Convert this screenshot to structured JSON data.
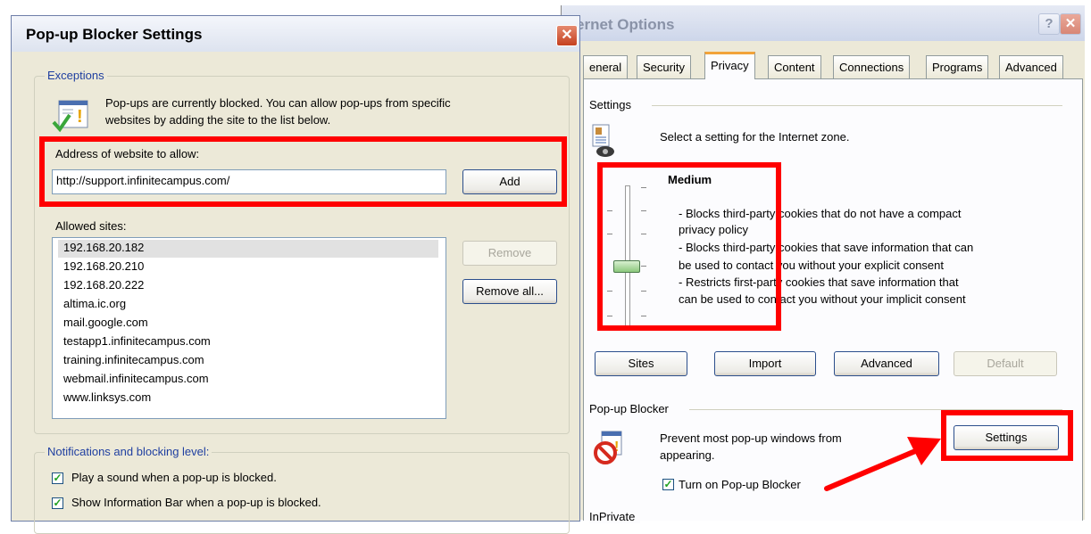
{
  "internet_options": {
    "title": "ernet Options",
    "help_glyph": "?",
    "close_glyph": "✕",
    "tabs": [
      "eneral",
      "Security",
      "Privacy",
      "Content",
      "Connections",
      "Programs",
      "Advanced"
    ],
    "settings_label": "Settings",
    "zone_text": "Select a setting for the Internet zone.",
    "level_name": "Medium",
    "level_desc": [
      "- Blocks third-party cookies that do not have a compact",
      "privacy policy",
      "- Blocks third-party cookies that save information that can",
      "be used to contact you without your explicit consent",
      "- Restricts first-party cookies that save information that",
      "can be used to contact you without your implicit consent"
    ],
    "buttons": {
      "sites": "Sites",
      "import": "Import",
      "advanced": "Advanced",
      "default": "Default"
    },
    "popup_label": "Pop-up Blocker",
    "popup_text_1": "Prevent most pop-up windows from",
    "popup_text_2": "appearing.",
    "popup_settings": "Settings",
    "turn_on_label": "Turn on Pop-up Blocker",
    "inprivate_label": "InPrivate"
  },
  "popup_blocker": {
    "title": "Pop-up Blocker Settings",
    "close_glyph": "✕",
    "exceptions_label": "Exceptions",
    "info_line_1": "Pop-ups are currently blocked.  You can allow pop-ups from specific",
    "info_line_2": "websites by adding the site to the list below.",
    "address_label": "Address of website to allow:",
    "address_value": "http://support.infinitecampus.com/",
    "add_button": "Add",
    "allowed_label": "Allowed sites:",
    "allowed_sites": [
      "192.168.20.182",
      "192.168.20.210",
      "192.168.20.222",
      "altima.ic.org",
      "mail.google.com",
      "testapp1.infinitecampus.com",
      "training.infinitecampus.com",
      "webmail.infinitecampus.com",
      "www.linksys.com"
    ],
    "remove_button": "Remove",
    "remove_all_button": "Remove all...",
    "notifications_label": "Notifications and blocking level:",
    "check_sound": "Play a sound when a pop-up is blocked.",
    "check_infobar": "Show Information Bar when a pop-up is blocked."
  },
  "colors": {
    "highlight": "#ff0000",
    "arrow": "#ff0000"
  }
}
